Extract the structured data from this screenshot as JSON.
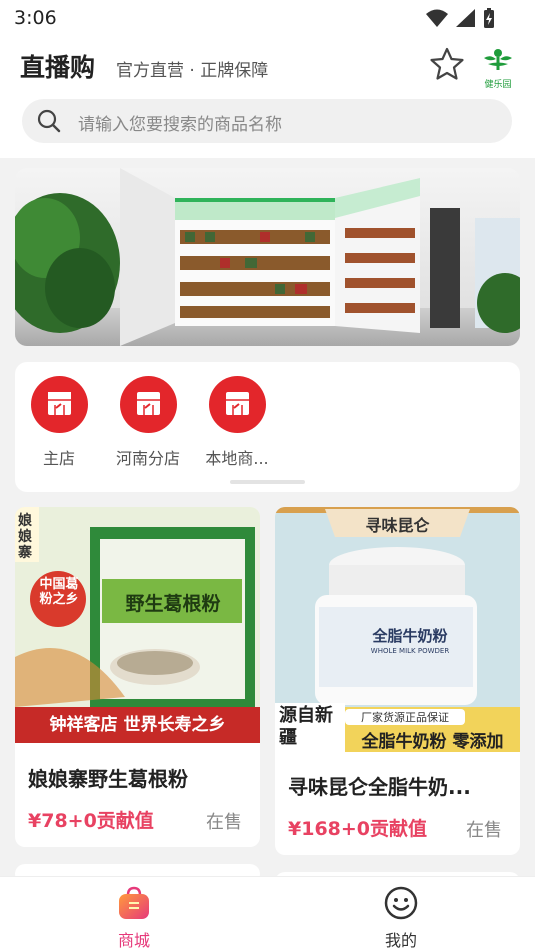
{
  "status_bar": {
    "time": "3:06"
  },
  "header": {
    "title": "直播购",
    "subtitle": "官方直营 · 正牌保障",
    "logo_text": "健乐园"
  },
  "search": {
    "placeholder": "请输入您要搜索的商品名称"
  },
  "stores": [
    {
      "label": "主店"
    },
    {
      "label": "河南分店"
    },
    {
      "label": "本地商..."
    }
  ],
  "products": [
    {
      "name": "娘娘寨野生葛根粉",
      "price": "¥78+0贡献值",
      "status": "在售",
      "image_text": {
        "brand_side": "娘娘寨",
        "badge": "中国葛粉之乡",
        "package_title": "野生葛根粉",
        "bottom_banner": "钟祥客店 世界长寿之乡"
      }
    },
    {
      "name": "寻味昆仑全脂牛奶...",
      "price": "¥168+0贡献值",
      "status": "在售",
      "image_text": {
        "top_brand": "寻味昆仑",
        "jar_label": "全脂牛奶粉",
        "jar_label_en": "WHOLE MILK POWDER",
        "origin": "源自新疆",
        "guarantee": "厂家货源正品保证",
        "bottom_banner": "全脂牛奶粉 零添加"
      }
    }
  ],
  "tabbar": {
    "tabs": [
      {
        "label": "商城",
        "active": true
      },
      {
        "label": "我的",
        "active": false
      }
    ]
  },
  "colors": {
    "accent": "#e3262b",
    "price": "#e84262",
    "tab_active": "#e6397a"
  }
}
